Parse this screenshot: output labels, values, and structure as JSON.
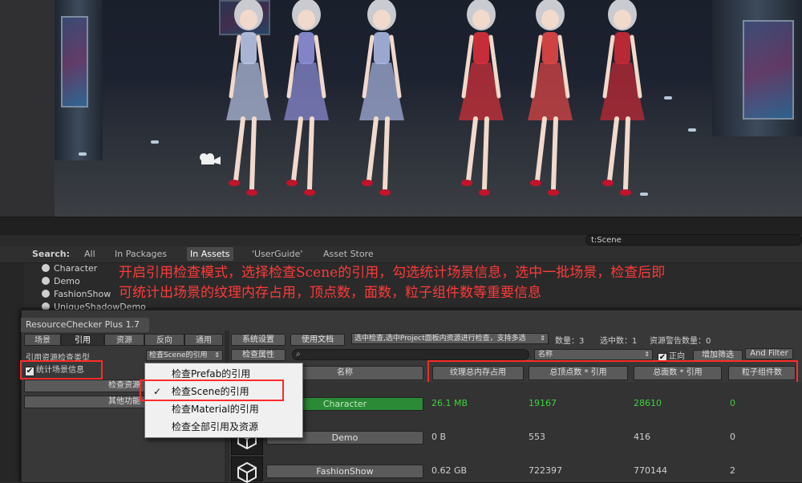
{
  "scene": {
    "camera_icon": "camera-icon",
    "figure_colors": [
      "#b9c4e6",
      "#8e8fd8",
      "#a9b7e2",
      "#d8303a",
      "#e24646",
      "#c82a36"
    ]
  },
  "project_search": {
    "query": "t:Scene",
    "label": "Search:",
    "filters": [
      "All",
      "In Packages",
      "In Assets",
      "'UserGuide'",
      "Asset Store"
    ],
    "active_filter": "In Assets",
    "items": [
      "Character",
      "Demo",
      "FashionShow",
      "UniqueShadowDemo"
    ]
  },
  "annotation": {
    "line1": "开启引用检查模式，选择检查Scene的引用，勾选统计场景信息，选中一批场景，检查后即",
    "line2": "可统计出场景的纹理内存占用，顶点数，面数，粒子组件数等重要信息",
    "color": "#ff3a3a"
  },
  "rc": {
    "title": "ResourceChecker Plus 1.7",
    "tabs": [
      "场景",
      "引用",
      "资源",
      "反向",
      "通用"
    ],
    "active_tab": "引用",
    "ref_type_label": "引用资源检查类型",
    "ref_type_value": "检查Scene的引用",
    "stat_checkbox_label": "统计场景信息",
    "stat_checked": "✔",
    "check_resource_btn": "检查资源",
    "other_func_btn": "其他功能",
    "system_settings_btn": "系统设置",
    "docs_btn": "使用文档",
    "check_props_btn": "检查属性",
    "select_scope": "选中检查,选中Project面板内资源进行检查，支持多选",
    "count_label": "数量：3",
    "selected_label": "选中数：1",
    "warning_label": "资源警告数量：0",
    "sort_value": "名称",
    "direction_label": "正向",
    "add_filter_btn": "增加筛选",
    "and_filter_btn": "And Filter",
    "popup_items": [
      "检查Prefab的引用",
      "检查Scene的引用",
      "检查Material的引用",
      "检查全部引用及资源"
    ],
    "popup_selected": "检查Scene的引用",
    "columns": [
      "名称",
      "纹理总内存占用",
      "总顶点数 * 引用",
      "总面数 * 引用",
      "粒子组件数"
    ],
    "rows": [
      {
        "name": "Character",
        "texture": "26.1 MB",
        "vertices": "19167",
        "faces": "28610",
        "particles": "0"
      },
      {
        "name": "Demo",
        "texture": "0 B",
        "vertices": "553",
        "faces": "416",
        "particles": "0"
      },
      {
        "name": "FashionShow",
        "texture": "0.62 GB",
        "vertices": "722397",
        "faces": "770144",
        "particles": "2"
      }
    ]
  }
}
